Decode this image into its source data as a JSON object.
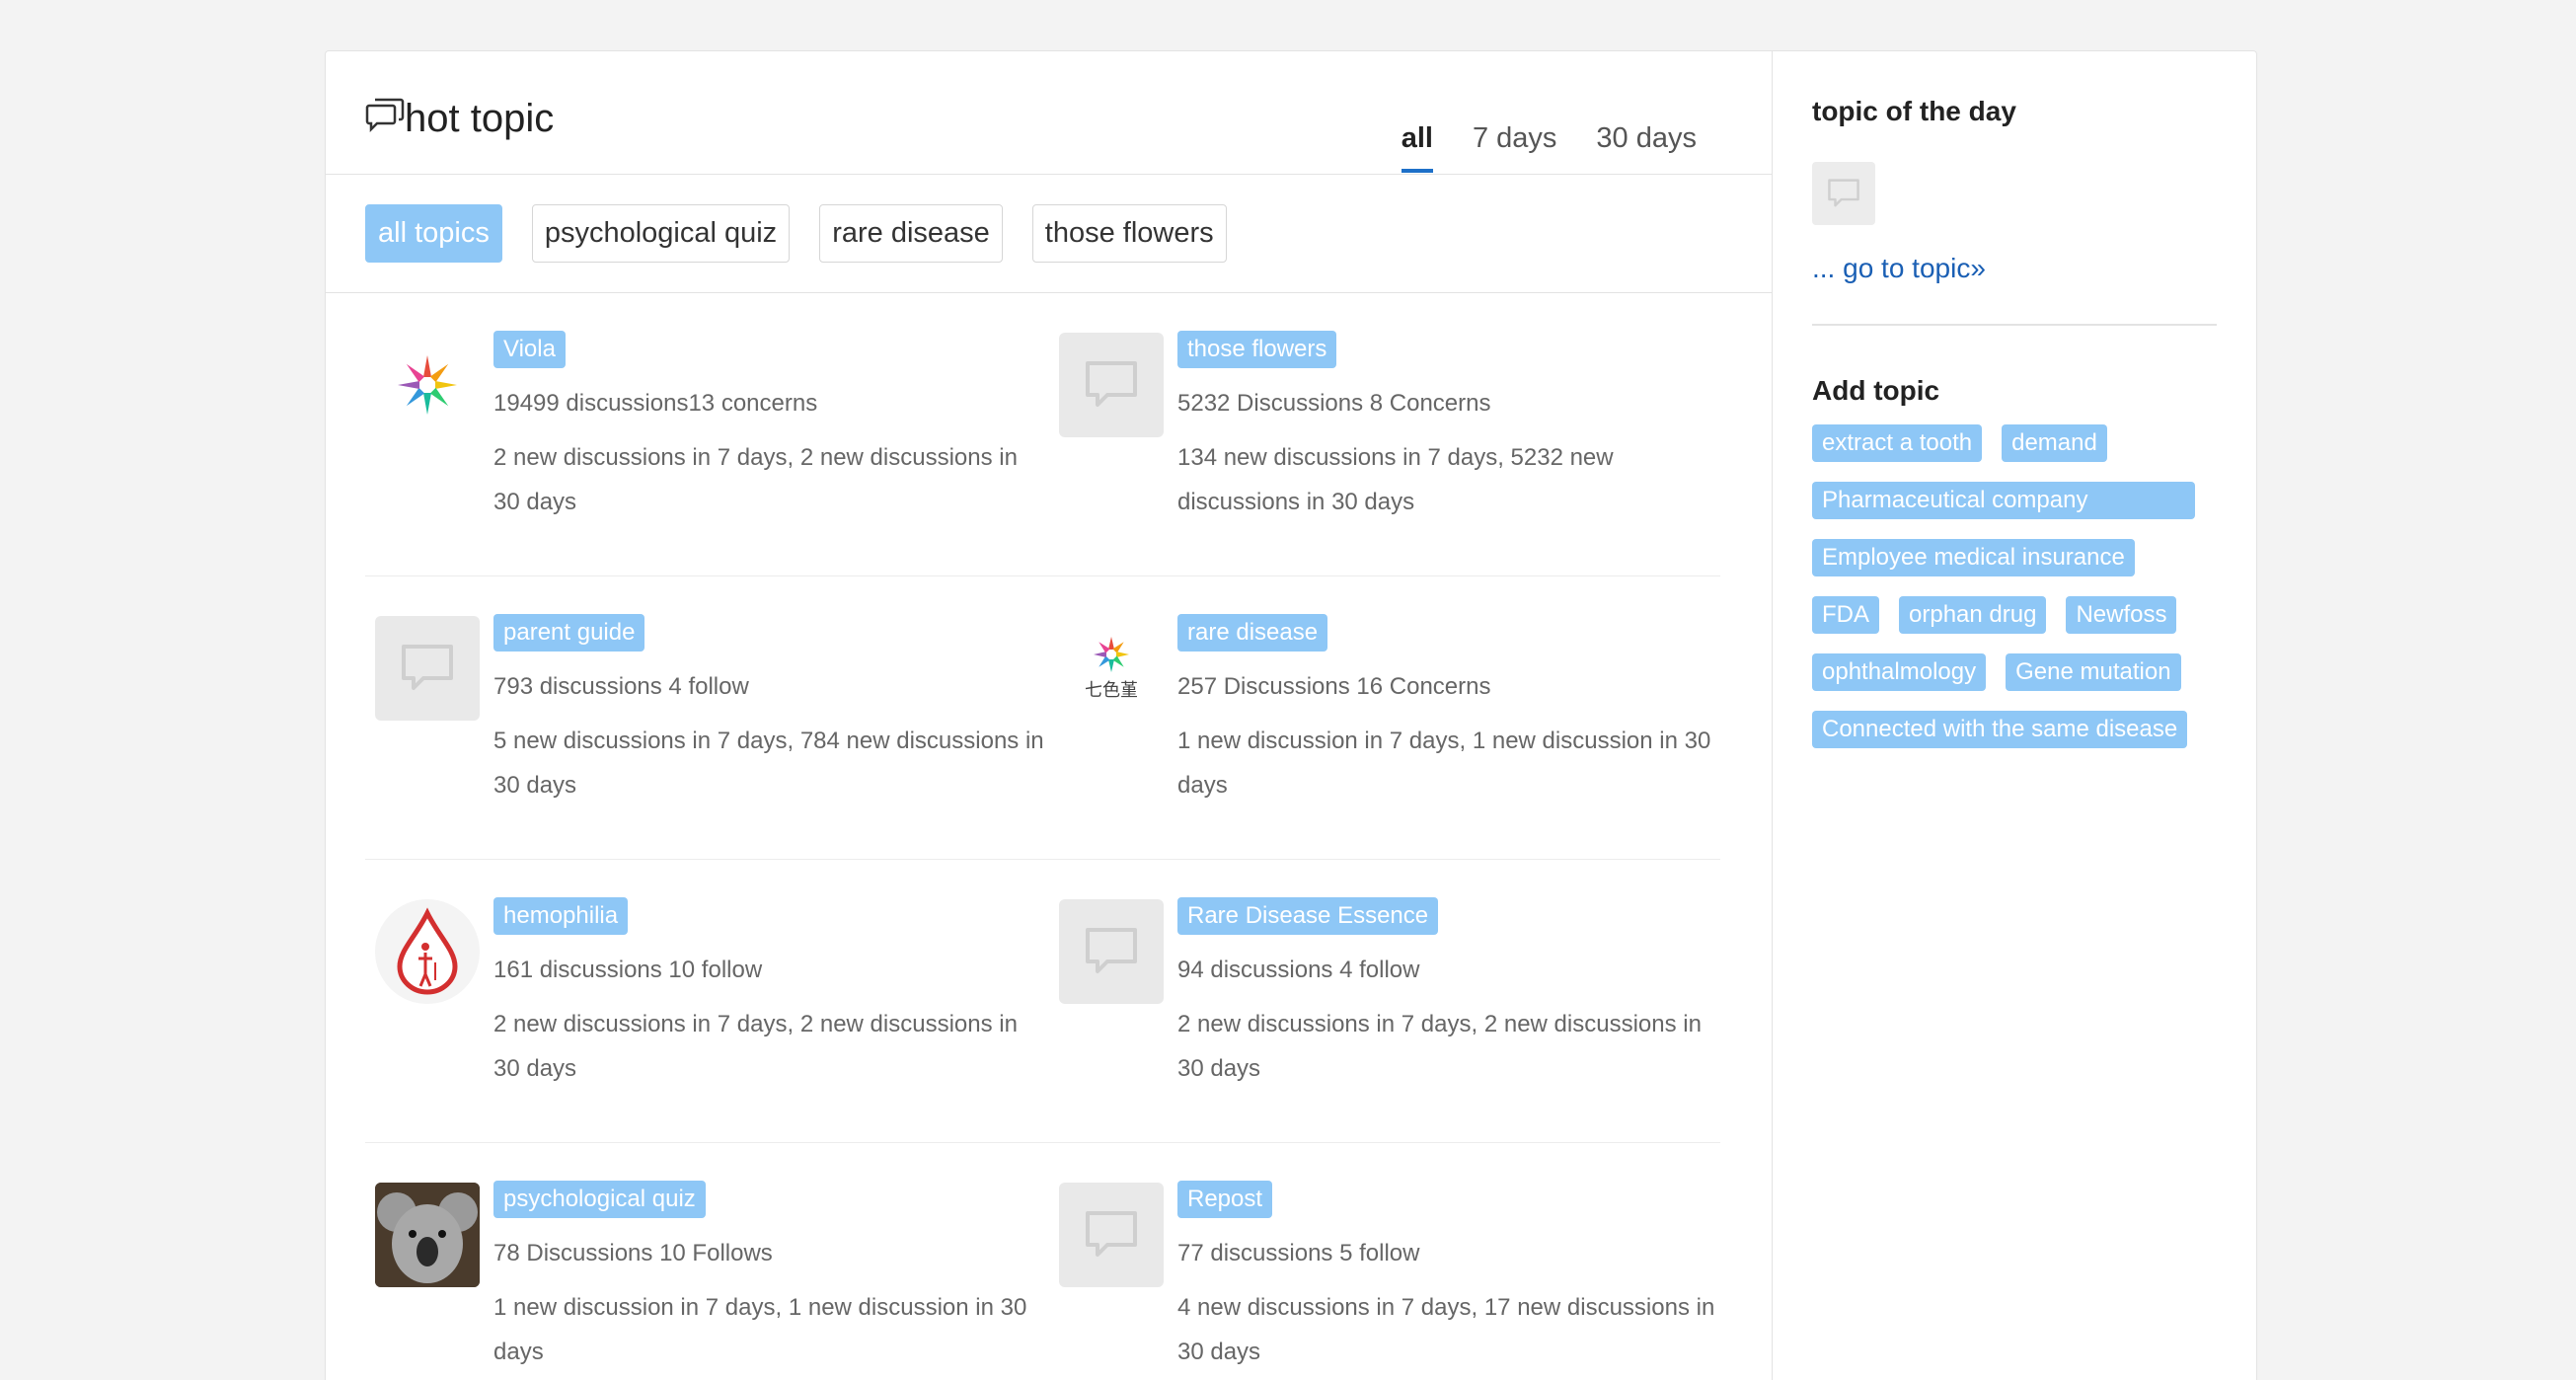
{
  "header": {
    "title": "hot topic",
    "tabs": [
      {
        "label": "all",
        "active": true
      },
      {
        "label": "7 days",
        "active": false
      },
      {
        "label": "30 days",
        "active": false
      }
    ]
  },
  "filters": [
    {
      "label": "all topics",
      "active": true
    },
    {
      "label": "psychological quiz",
      "active": false
    },
    {
      "label": "rare disease",
      "active": false
    },
    {
      "label": "those flowers",
      "active": false
    }
  ],
  "topics": [
    {
      "name": "Viola",
      "stats": "19499 discussions13 concerns",
      "recent": "2 new discussions in 7 days, 2 new discussions in 30 days",
      "icon": "flower-logo-icon"
    },
    {
      "name": "those flowers",
      "stats": "5232 Discussions 8 Concerns",
      "recent": "134 new discussions in 7 days, 5232 new discussions in 30 days",
      "icon": "chat-bubble-icon"
    },
    {
      "name": "parent guide",
      "stats": "793 discussions 4 follow",
      "recent": "5 new discussions in 7 days, 784 new discussions in 30 days",
      "icon": "chat-bubble-icon"
    },
    {
      "name": "rare disease",
      "stats": "257 Discussions 16 Concerns",
      "recent": "1 new discussion in 7 days, 1 new discussion in 30 days",
      "icon": "flower-logo-icon",
      "logo_text": "七色堇"
    },
    {
      "name": "hemophilia",
      "stats": "161 discussions 10 follow",
      "recent": "2 new discussions in 7 days, 2 new discussions in 30 days",
      "icon": "blood-drop-icon"
    },
    {
      "name": "Rare Disease Essence",
      "stats": "94 discussions 4 follow",
      "recent": "2 new discussions in 7 days, 2 new discussions in 30 days",
      "icon": "chat-bubble-icon"
    },
    {
      "name": "psychological quiz",
      "stats": "78 Discussions 10 Follows",
      "recent": "1 new discussion in 7 days, 1 new discussion in 30 days",
      "icon": "koala-photo-icon"
    },
    {
      "name": "Repost",
      "stats": "77 discussions 5 follow",
      "recent": "4 new discussions in 7 days, 17 new discussions in 30 days",
      "icon": "chat-bubble-icon"
    }
  ],
  "sidebar": {
    "topic_of_day_title": "topic of the day",
    "go_to_topic": "... go to topic»",
    "add_topic_title": "Add topic",
    "tags": [
      "extract a tooth",
      "demand",
      "Pharmaceutical company",
      "Employee medical insurance",
      "FDA",
      "orphan drug",
      "Newfoss",
      "ophthalmology",
      "Gene mutation",
      "Connected with the same disease"
    ]
  },
  "colors": {
    "accent": "#8ec7f6",
    "link": "#1a5fb4",
    "tab_underline": "#1e70c8"
  }
}
